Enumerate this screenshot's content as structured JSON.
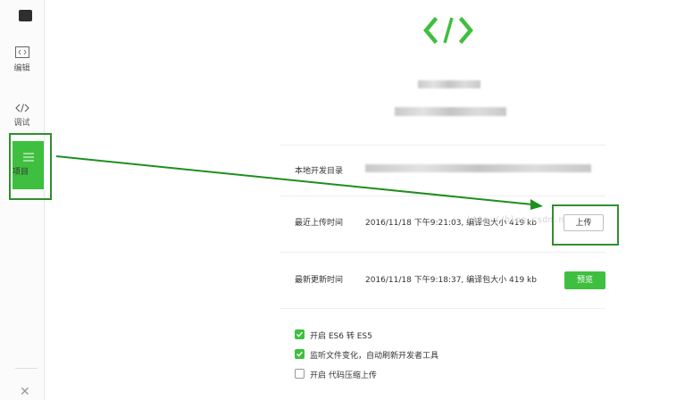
{
  "sidebar": {
    "edit_label": "编辑",
    "debug_label": "调试",
    "project_label": "项目"
  },
  "main": {
    "local_dir_label": "本地开发目录",
    "upload_time_label": "最近上传时间",
    "upload_time_value": "2016/11/18 下午9:21:03, 编译包大小 419 kb",
    "update_time_label": "最新更新时间",
    "update_time_value": "2016/11/18 下午9:18:37, 编译包大小 419 kb",
    "upload_button": "上传",
    "preview_button": "预览",
    "options": [
      {
        "label": "开启 ES6 转 ES5",
        "checked": true
      },
      {
        "label": "监听文件变化，自动刷新开发者工具",
        "checked": true
      },
      {
        "label": "开启 代码压缩上传",
        "checked": false
      }
    ],
    "watermark": "http://blog.csdn.net/"
  },
  "colors": {
    "accent": "#3fbf3f",
    "highlight": "#2f8f2f"
  },
  "icons": [
    "code-icon",
    "edit-icon",
    "menu-icon",
    "close-icon",
    "checkbox-check-icon"
  ]
}
